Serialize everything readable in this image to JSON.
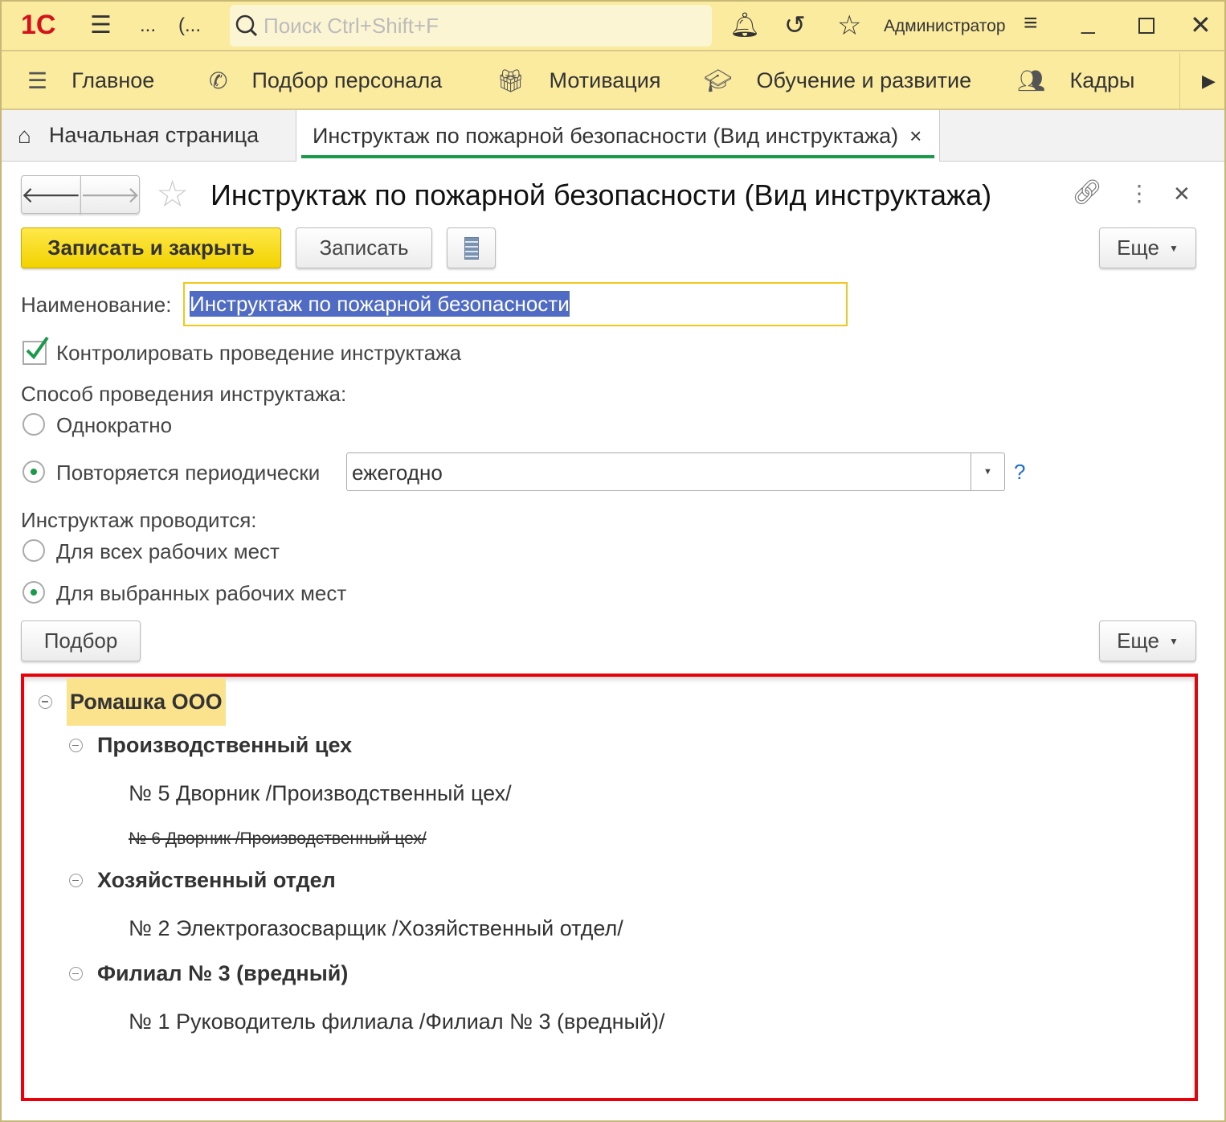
{
  "topbar": {
    "logo": "1С",
    "dots": "...",
    "paren": "(...",
    "search_placeholder": "Поиск Ctrl+Shift+F",
    "user": "Администратор"
  },
  "nav": {
    "items": [
      {
        "label": "Главное"
      },
      {
        "label": "Подбор персонала"
      },
      {
        "label": "Мотивация"
      },
      {
        "label": "Обучение и развитие"
      },
      {
        "label": "Кадры"
      }
    ]
  },
  "tabs": {
    "home": "Начальная страница",
    "active": "Инструктаж по пожарной безопасности (Вид инструктажа)",
    "close": "×"
  },
  "form": {
    "title": "Инструктаж по пожарной безопасности (Вид инструктажа)",
    "save_close": "Записать и закрыть",
    "save": "Записать",
    "more": "Еще",
    "name_label": "Наименование:",
    "name_value": "Инструктаж по пожарной безопасности",
    "control_label": "Контролировать проведение инструктажа",
    "control_checked": true,
    "method_label": "Способ проведения инструктажа:",
    "method_once": "Однократно",
    "method_periodic": "Повторяется периодически",
    "period_value": "ежегодно",
    "help": "?",
    "scope_label": "Инструктаж проводится:",
    "scope_all": "Для всех рабочих мест",
    "scope_selected": "Для выбранных рабочих мест",
    "pick": "Подбор",
    "more2": "Еще"
  },
  "tree": {
    "root": "Ромашка ООО",
    "groups": [
      {
        "name": "Производственный цех",
        "items": [
          {
            "label": "№ 5 Дворник /Производственный цех/",
            "deleted": false
          },
          {
            "label": "№ 6 Дворник /Производственный цех/",
            "deleted": true
          }
        ]
      },
      {
        "name": "Хозяйственный отдел",
        "items": [
          {
            "label": "№ 2 Электрогазосварщик /Хозяйственный отдел/",
            "deleted": false
          }
        ]
      },
      {
        "name": "Филиал № 3 (вредный)",
        "items": [
          {
            "label": "№ 1 Руководитель филиала /Филиал № 3 (вредный)/",
            "deleted": false
          }
        ]
      }
    ]
  },
  "colors": {
    "accent": "#fbeb9f",
    "primary_button": "#f5d800",
    "tab_underline": "#1a9a4a",
    "highlight": "#e8000b"
  }
}
